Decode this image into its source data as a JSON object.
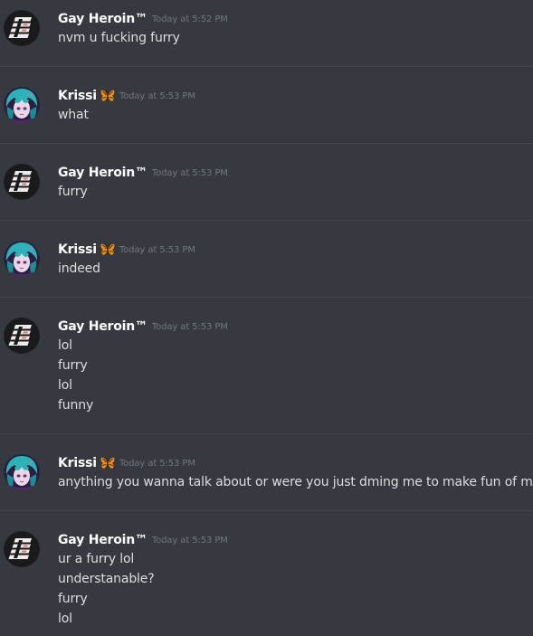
{
  "messages": [
    {
      "author": "Gay Heroin™",
      "avatar": "tde-logo-avatar",
      "badge": null,
      "timestamp": "Today at 5:52 PM",
      "lines": [
        "nvm u fucking furry"
      ]
    },
    {
      "author": "Krissi",
      "avatar": "anime-girl-avatar",
      "badge": "butterfly-emoji",
      "timestamp": "Today at 5:53 PM",
      "lines": [
        "what"
      ]
    },
    {
      "author": "Gay Heroin™",
      "avatar": "tde-logo-avatar",
      "badge": null,
      "timestamp": "Today at 5:53 PM",
      "lines": [
        "furry"
      ]
    },
    {
      "author": "Krissi",
      "avatar": "anime-girl-avatar",
      "badge": "butterfly-emoji",
      "timestamp": "Today at 5:53 PM",
      "lines": [
        "indeed"
      ]
    },
    {
      "author": "Gay Heroin™",
      "avatar": "tde-logo-avatar",
      "badge": null,
      "timestamp": "Today at 5:53 PM",
      "lines": [
        "lol",
        "furry",
        "lol",
        "funny"
      ]
    },
    {
      "author": "Krissi",
      "avatar": "anime-girl-avatar",
      "badge": "butterfly-emoji",
      "timestamp": "Today at 5:53 PM",
      "lines": [
        "anything you wanna talk about or were you just dming me to make fun of me"
      ]
    },
    {
      "author": "Gay Heroin™",
      "avatar": "tde-logo-avatar",
      "badge": null,
      "timestamp": "Today at 5:53 PM",
      "lines": [
        "ur a furry lol",
        "understanable?",
        "furry",
        "lol"
      ]
    }
  ],
  "colors": {
    "background": "#36393f",
    "divider": "#42454a",
    "username": "#ffffff",
    "text": "#dcddde",
    "timestamp": "#72767d",
    "butterfly": "#f4900c"
  }
}
